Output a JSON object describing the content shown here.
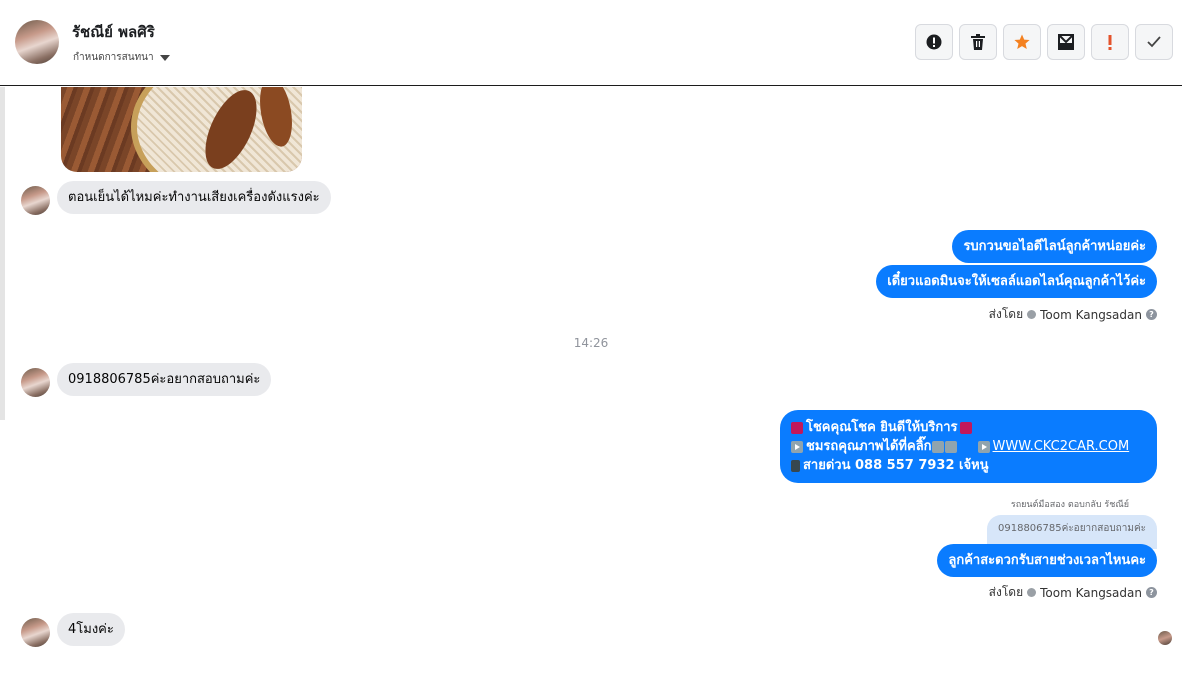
{
  "header": {
    "contact_name": "รัชณีย์ พลศิริ",
    "subtitle": "กำหนดการสนทนา",
    "actions": [
      {
        "name": "report-icon",
        "glyph": "!"
      },
      {
        "name": "trash-icon",
        "glyph": ""
      },
      {
        "name": "star-icon",
        "glyph": "★"
      },
      {
        "name": "mark-unread-icon",
        "glyph": ""
      },
      {
        "name": "important-icon",
        "glyph": "!"
      },
      {
        "name": "check-icon",
        "glyph": "✓"
      }
    ]
  },
  "messages": {
    "in1": "ตอนเย็นได้ไหมค่ะทำงานเสียงเครื่องดังแรงค่ะ",
    "out1": "รบกวนขอไอดีไลน์ลูกค้าหน่อยค่ะ",
    "out2": "เดี๋ยวแอดมินจะให้เซลล์แอดไลน์คุณลูกค้าไว้ค่ะ",
    "sent_by_label": "ส่งโดย",
    "sender_name": "Toom Kangsadan",
    "time": "14:26",
    "in2": "0918806785ค่ะอยากสอบถามค่ะ",
    "promo_line1": "โชคคุณโชค ยินดีให้บริการ",
    "promo_line2": "ชมรถคุณภาพได้ที่คลิ๊ก",
    "promo_link": "WWW.CKC2CAR.COM",
    "promo_line3": "สายด่วน 088 557 7932 เจ้หนู",
    "reply_note": "รถยนต์มือสอง ตอบกลับ รัชณีย์",
    "quoted_text": "0918806785ค่ะอยากสอบถามค่ะ",
    "out3": "ลูกค้าสะดวกรับสายช่วงเวลาไหนคะ",
    "in3": "4โมงค่ะ"
  },
  "colors": {
    "outgoing_bubble": "#0a7cff",
    "incoming_bubble": "#e9eaed",
    "quote_bubble": "#d7e6f9",
    "star": "#f48120",
    "important": "#e4532b"
  }
}
